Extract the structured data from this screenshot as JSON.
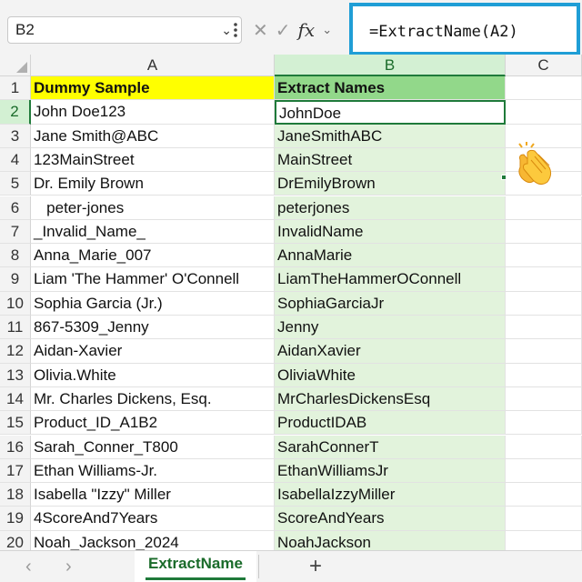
{
  "formula_bar": {
    "name_box": "B2",
    "formula": "=ExtractName(A2)",
    "fx_label": "fx"
  },
  "columns": [
    "A",
    "B",
    "C"
  ],
  "rows": [
    {
      "num": "1",
      "a": "Dummy Sample",
      "b": "Extract Names"
    },
    {
      "num": "2",
      "a": "John Doe123",
      "b": "JohnDoe"
    },
    {
      "num": "3",
      "a": "Jane Smith@ABC",
      "b": "JaneSmithABC"
    },
    {
      "num": "4",
      "a": "123MainStreet",
      "b": "MainStreet"
    },
    {
      "num": "5",
      "a": "Dr. Emily Brown",
      "b": "DrEmilyBrown"
    },
    {
      "num": "6",
      "a": "   peter-jones",
      "b": "peterjones"
    },
    {
      "num": "7",
      "a": "_Invalid_Name_",
      "b": "InvalidName"
    },
    {
      "num": "8",
      "a": "Anna_Marie_007",
      "b": "AnnaMarie"
    },
    {
      "num": "9",
      "a": "Liam 'The Hammer' O'Connell",
      "b": "LiamTheHammerOConnell"
    },
    {
      "num": "10",
      "a": "Sophia Garcia (Jr.)",
      "b": "SophiaGarciaJr"
    },
    {
      "num": "11",
      "a": "867-5309_Jenny",
      "b": "Jenny"
    },
    {
      "num": "12",
      "a": "Aidan-Xavier",
      "b": "AidanXavier"
    },
    {
      "num": "13",
      "a": "Olivia.White",
      "b": "OliviaWhite"
    },
    {
      "num": "14",
      "a": "Mr. Charles Dickens, Esq.",
      "b": "MrCharlesDickensEsq"
    },
    {
      "num": "15",
      "a": "Product_ID_A1B2",
      "b": "ProductIDAB"
    },
    {
      "num": "16",
      "a": "Sarah_Conner_T800",
      "b": "SarahConnerT"
    },
    {
      "num": "17",
      "a": "Ethan Williams-Jr.",
      "b": "EthanWilliamsJr"
    },
    {
      "num": "18",
      "a": "Isabella \"Izzy\" Miller",
      "b": "IsabellaIzzyMiller"
    },
    {
      "num": "19",
      "a": "4ScoreAnd7Years",
      "b": "ScoreAndYears"
    },
    {
      "num": "20",
      "a": "Noah_Jackson_2024",
      "b": "NoahJackson"
    }
  ],
  "sheet_tabs": {
    "active": "ExtractName",
    "prev_icon": "chevron-left-icon",
    "next_icon": "chevron-right-icon",
    "add_icon": "plus-icon"
  },
  "colors": {
    "header_a": "#ffff00",
    "header_b": "#92d88a",
    "column_b": "#e2f3dc",
    "accent": "#1f7a3a",
    "highlight_border": "#1f9ed6"
  }
}
